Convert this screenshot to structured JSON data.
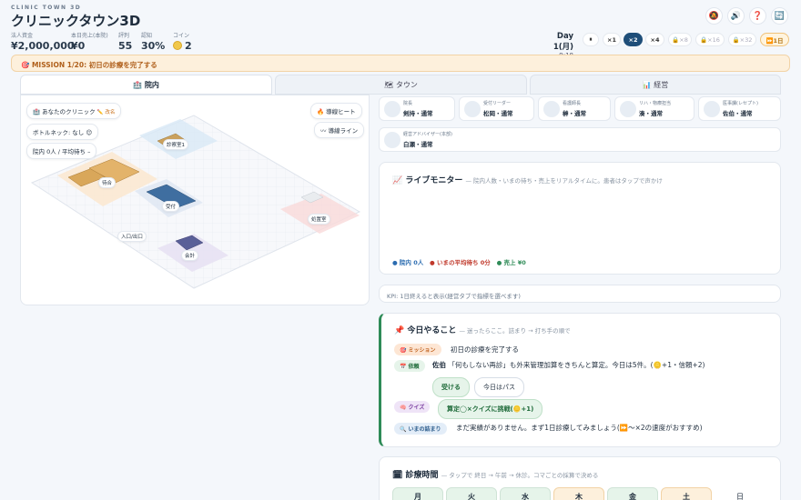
{
  "header": {
    "brand_sub": "CLINIC TOWN 3D",
    "brand": "クリニックタウン3D",
    "stats": [
      {
        "label": "法人資金",
        "value": "¥2,000,000"
      },
      {
        "label": "本日売上(本院)",
        "value": "¥0"
      },
      {
        "label": "評判",
        "value": "55"
      },
      {
        "label": "認知",
        "value": "30%"
      },
      {
        "label": "コイン",
        "value": "2"
      }
    ],
    "day": "Day 1(月)",
    "time": "9:18",
    "icons": [
      "🔕",
      "🔊",
      "❓",
      "🔄"
    ],
    "speeds": [
      "⏸",
      "×1",
      "×2",
      "×4",
      "🔒×8",
      "🔒×16",
      "🔒×32",
      "⏩1日"
    ]
  },
  "mission": "🎯 MISSION 1/20: 初日の診療を完了する",
  "tabs": [
    "🏥 院内",
    "🗺 タウン",
    "📊 経営"
  ],
  "map": {
    "clinic": "🏥 あなたのクリニック",
    "rename": "✏️ 改名",
    "bottleneck": "ボトルネック: なし 😌",
    "status": "院内 0人 / 平均待ち –",
    "heat": "🔥 導線ヒート",
    "line": "〰 導線ライン",
    "rooms": [
      "診察室1",
      "待合",
      "受付",
      "処置室",
      "入口/出口",
      "会計"
    ]
  },
  "staff": [
    {
      "role": "院長",
      "name": "剣持・通常"
    },
    {
      "role": "受付リーダー",
      "name": "松岡・通常"
    },
    {
      "role": "看護師長",
      "name": "榊・通常"
    },
    {
      "role": "リハ・物療担当",
      "name": "湊・通常"
    },
    {
      "role": "医事課(レセプト)",
      "name": "佐伯・通常"
    },
    {
      "role": "経営アドバイザー(本部)",
      "name": "白瀬・通常"
    }
  ],
  "live": {
    "title": "📈 ライブモニター",
    "sub": "— 院内人数・いまの待ち・売上をリアルタイムに。患者はタップで声かけ",
    "legend": [
      "● 院内 0人",
      "● いまの平均待ち 0分",
      "● 売上 ¥0"
    ]
  },
  "kpi": "KPI: 1日終えると表示(経営タブで指標を選べます)",
  "todo": {
    "title": "📌 今日やること",
    "sub": "— 迷ったらここ。詰まり → 打ち手の順で",
    "mission_tag": "🎯 ミッション",
    "mission_text": "初日の診療を完了する",
    "req_tag": "📅 依頼",
    "req_name": "佐伯",
    "req_text": "「何もしない再診」も外来管理加算をきちんと算定。今日は5件。(🪙+1・信頼+2)",
    "accept": "受ける",
    "pass": "今日はパス",
    "quiz_tag": "🧠 クイズ",
    "quiz_btn": "算定◯×クイズに挑戦(🪙+1)",
    "stuck_tag": "🔍 いまの詰まり",
    "stuck_text": "まだ実績がありません。まず1日診療してみましょう(⏩〜×2の速度がおすすめ)"
  },
  "hours": {
    "title": "🗓 診療時間",
    "sub": "— タップで 終日 → 午前 → 休診。コマごとの採算で決める",
    "days": [
      "月",
      "火",
      "水",
      "木",
      "金",
      "土",
      "日"
    ]
  }
}
